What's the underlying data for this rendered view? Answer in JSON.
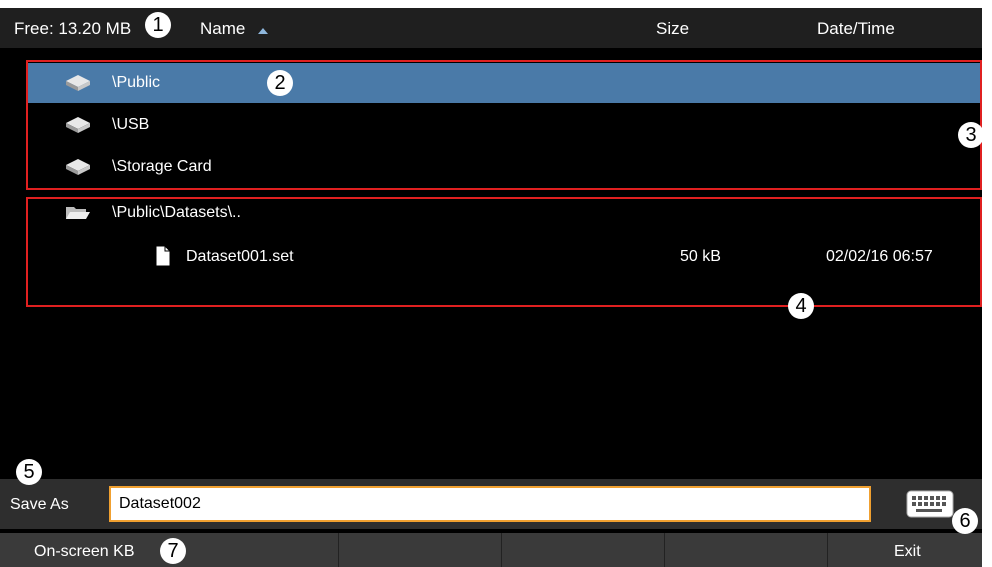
{
  "header": {
    "free_label": "Free: 13.20 MB",
    "col_name": "Name",
    "col_size": "Size",
    "col_datetime": "Date/Time"
  },
  "drives": [
    {
      "label": "\\Public",
      "icon": "drive-icon",
      "selected": true
    },
    {
      "label": "\\USB",
      "icon": "drive-icon",
      "selected": false
    },
    {
      "label": "\\Storage Card",
      "icon": "drive-icon",
      "selected": false
    }
  ],
  "folder": {
    "label": "\\Public\\Datasets\\..",
    "icon": "open-folder-icon"
  },
  "files": [
    {
      "name": "Dataset001.set",
      "size": "50 kB",
      "datetime": "02/02/16 06:57",
      "icon": "file-icon"
    }
  ],
  "save": {
    "label": "Save As",
    "value": "Dataset002"
  },
  "softkeys": {
    "onscreen_kb": "On-screen KB",
    "exit": "Exit"
  },
  "callouts": [
    "1",
    "2",
    "3",
    "4",
    "5",
    "6",
    "7"
  ],
  "colors": {
    "selected_row": "#4a7aa8",
    "highlight_box": "#e02020",
    "input_border": "#f0a030"
  }
}
